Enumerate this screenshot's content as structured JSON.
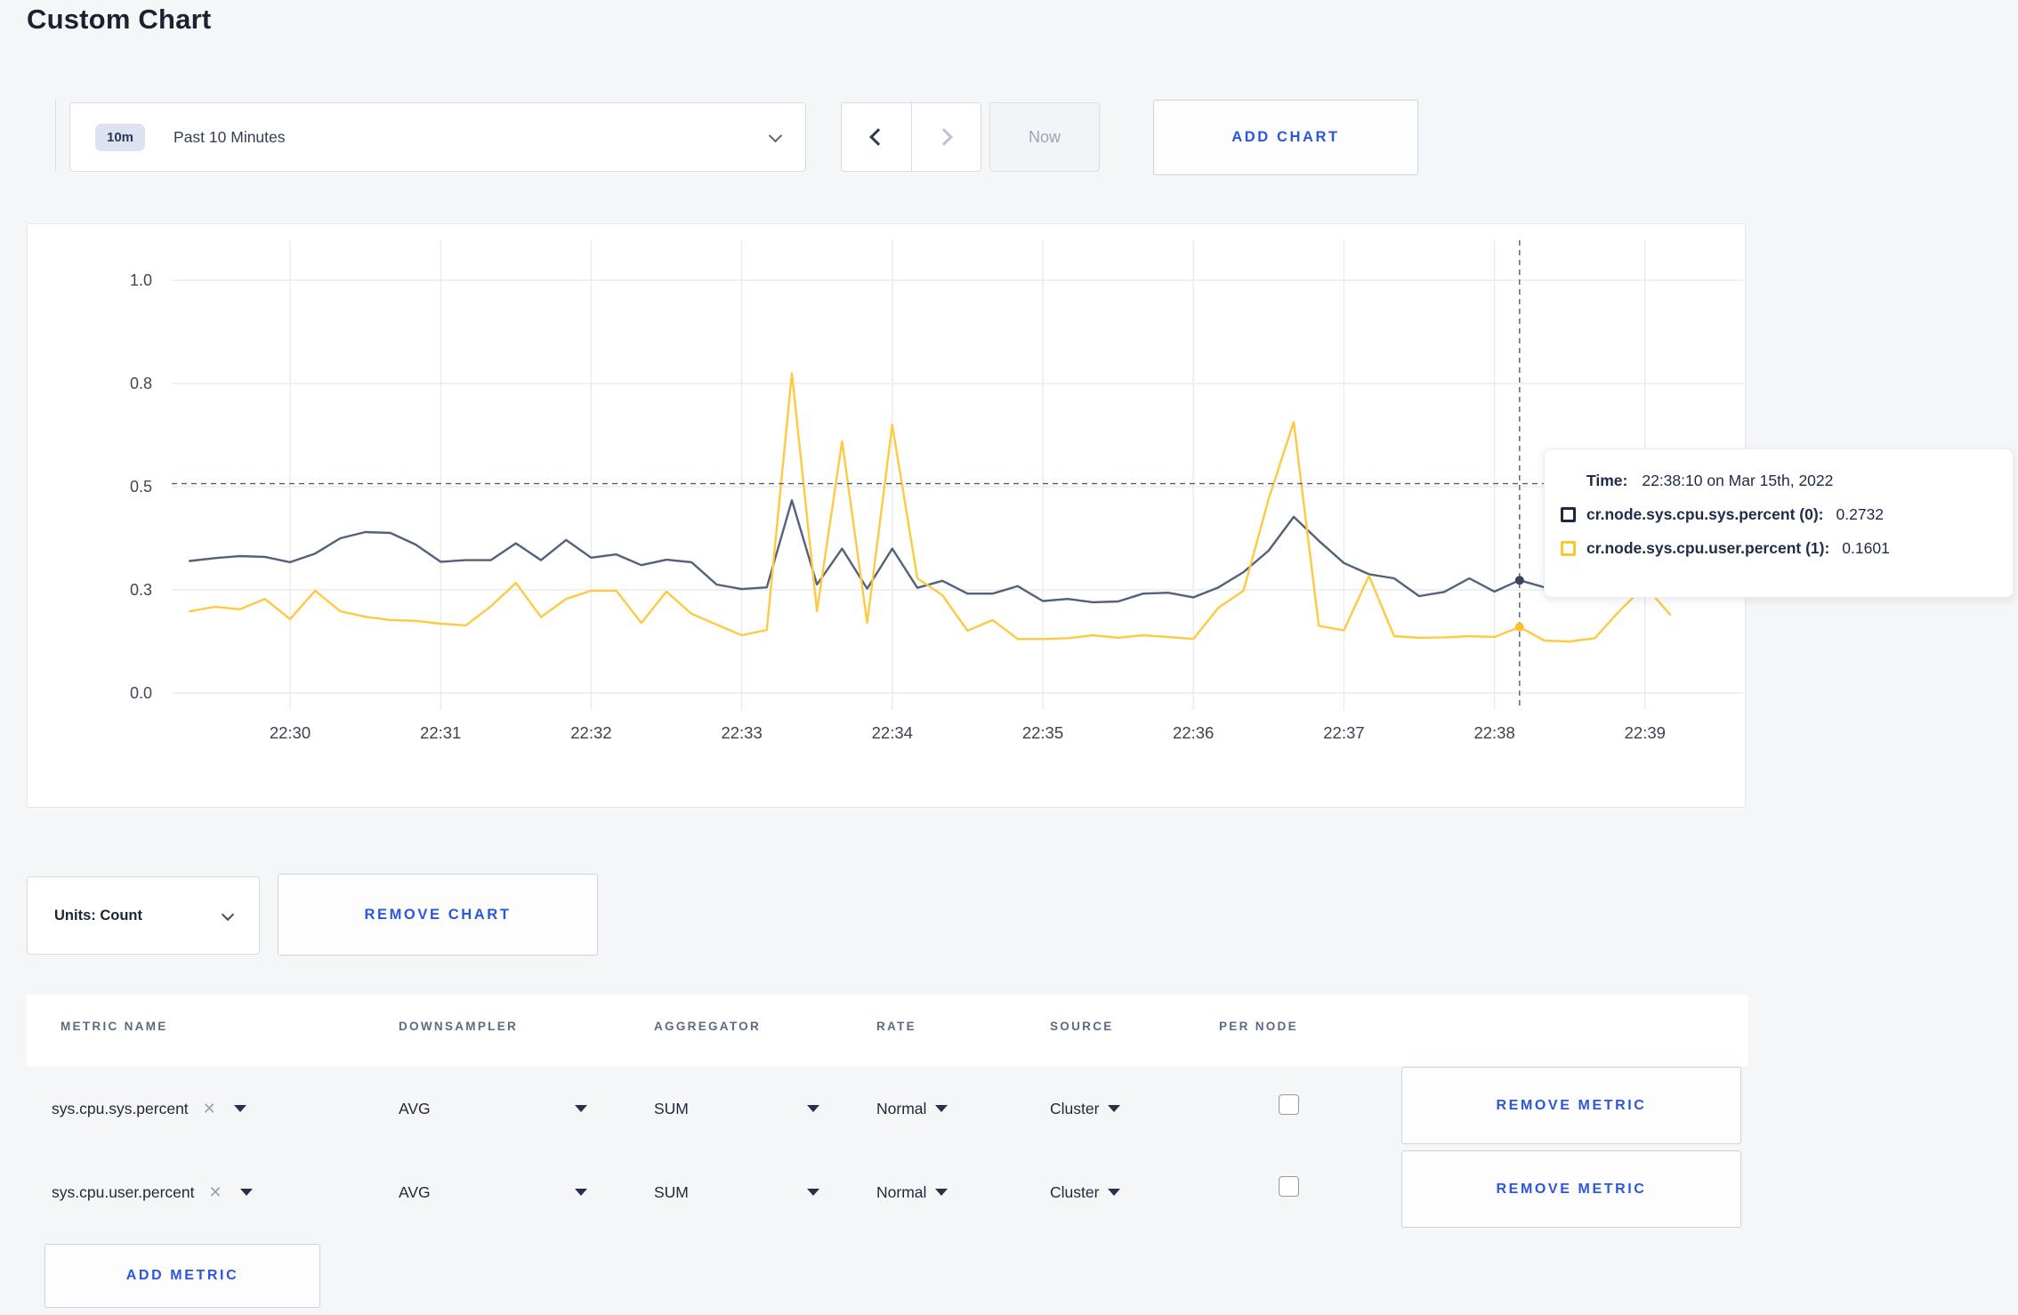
{
  "page": {
    "title": "Custom Chart"
  },
  "toolbar": {
    "time_window_badge": "10m",
    "time_window_label": "Past 10 Minutes",
    "now_label": "Now",
    "add_chart_label": "ADD CHART"
  },
  "units_bar": {
    "units_label": "Units: Count",
    "remove_chart_label": "REMOVE CHART"
  },
  "chart_data": {
    "type": "line",
    "title": "",
    "xlabel": "",
    "ylabel": "",
    "grid": true,
    "legend_position": "tooltip",
    "y_axis": {
      "range": [
        0,
        1
      ],
      "ticks": [
        {
          "v": 0,
          "label": "0.0"
        },
        {
          "v": 0.25,
          "label": "0.3"
        },
        {
          "v": 0.5,
          "label": "0.5"
        },
        {
          "v": 0.75,
          "label": "0.8"
        },
        {
          "v": 1,
          "label": "1.0"
        }
      ]
    },
    "x_axis": {
      "unit": "minutes_after_22:29",
      "ticks": [
        {
          "m": 1,
          "label": "22:30"
        },
        {
          "m": 2,
          "label": "22:31"
        },
        {
          "m": 3,
          "label": "22:32"
        },
        {
          "m": 4,
          "label": "22:33"
        },
        {
          "m": 5,
          "label": "22:34"
        },
        {
          "m": 6,
          "label": "22:35"
        },
        {
          "m": 7,
          "label": "22:36"
        },
        {
          "m": 8,
          "label": "22:37"
        },
        {
          "m": 9,
          "label": "22:38"
        },
        {
          "m": 10,
          "label": "22:39"
        }
      ]
    },
    "sample_start_min": 0.33333,
    "sample_interval_min": 0.16667,
    "series": [
      {
        "name": "cr.node.sys.cpu.sys.percent",
        "color": "#52617c",
        "values": [
          0.32,
          0.327,
          0.332,
          0.33,
          0.317,
          0.338,
          0.375,
          0.39,
          0.388,
          0.36,
          0.318,
          0.322,
          0.322,
          0.363,
          0.322,
          0.371,
          0.328,
          0.336,
          0.31,
          0.323,
          0.317,
          0.263,
          0.252,
          0.256,
          0.467,
          0.263,
          0.35,
          0.253,
          0.35,
          0.255,
          0.272,
          0.241,
          0.241,
          0.259,
          0.223,
          0.228,
          0.22,
          0.222,
          0.241,
          0.243,
          0.232,
          0.256,
          0.293,
          0.345,
          0.427,
          0.369,
          0.315,
          0.288,
          0.278,
          0.235,
          0.245,
          0.278,
          0.246,
          0.2732,
          0.256,
          0.262,
          0.27,
          0.282,
          0.295,
          0.298
        ]
      },
      {
        "name": "cr.node.sys.cpu.user.percent",
        "color": "#ffc940",
        "values": [
          0.198,
          0.209,
          0.203,
          0.228,
          0.179,
          0.248,
          0.198,
          0.185,
          0.177,
          0.175,
          0.168,
          0.164,
          0.21,
          0.267,
          0.184,
          0.228,
          0.248,
          0.248,
          0.17,
          0.246,
          0.192,
          0.166,
          0.14,
          0.153,
          0.775,
          0.198,
          0.61,
          0.17,
          0.65,
          0.278,
          0.237,
          0.151,
          0.177,
          0.131,
          0.131,
          0.133,
          0.14,
          0.134,
          0.14,
          0.136,
          0.131,
          0.207,
          0.248,
          0.47,
          0.657,
          0.163,
          0.152,
          0.284,
          0.138,
          0.134,
          0.135,
          0.138,
          0.136,
          0.1601,
          0.127,
          0.125,
          0.133,
          0.2,
          0.26,
          0.19
        ]
      }
    ],
    "crosshair": {
      "time_min": 9.16667,
      "value_line": 0.5075,
      "sys_point": 0.2732,
      "user_point": 0.1601
    }
  },
  "tooltip": {
    "time_label": "Time:",
    "time_value": "22:38:10 on Mar 15th, 2022",
    "rows": [
      {
        "series": "cr.node.sys.cpu.sys.percent (0):",
        "value": "0.2732",
        "color": "#1b2845"
      },
      {
        "series": "cr.node.sys.cpu.user.percent (1):",
        "value": "0.1601",
        "color": "#fec62e"
      }
    ]
  },
  "metrics_table": {
    "headers": [
      "METRIC NAME",
      "DOWNSAMPLER",
      "AGGREGATOR",
      "RATE",
      "SOURCE",
      "PER NODE"
    ],
    "rows": [
      {
        "metric_name": "sys.cpu.sys.percent",
        "downsampler": "AVG",
        "aggregator": "SUM",
        "rate": "Normal",
        "source": "Cluster",
        "per_node_checked": false,
        "remove_label": "REMOVE METRIC"
      },
      {
        "metric_name": "sys.cpu.user.percent",
        "downsampler": "AVG",
        "aggregator": "SUM",
        "rate": "Normal",
        "source": "Cluster",
        "per_node_checked": false,
        "remove_label": "REMOVE METRIC"
      }
    ],
    "add_metric_label": "ADD METRIC"
  }
}
